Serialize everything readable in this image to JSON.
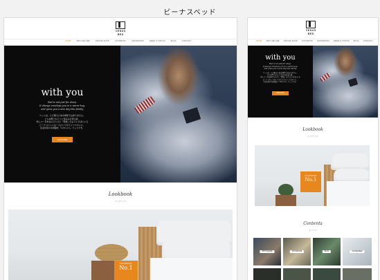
{
  "page_title": "ビーナスベッド",
  "brand": {
    "line1": "VENUS",
    "line2": "BED"
  },
  "nav": [
    "HOME",
    "WHO WE ARE",
    "ONLINE SHOP",
    "LOOKBOOK",
    "SHOWROOM",
    "NEWS & TOPICS",
    "BLOG",
    "CONTACT"
  ],
  "hero": {
    "heading": "with you",
    "sub": [
      "Bed is not just for sleep.",
      "It always envelops you in a warm hug,",
      "and gives you a new day like family."
    ],
    "jp": [
      "ベッドは、ただ眠るための場所ではありません。",
      "どんな時でもそっと包み込む安心感、",
      "新しい一日を迎えるたびに「家族」のようにそばにいる",
      "ビーナスベッドは一人ひとりのライフスタイル、",
      "生活の様々な場面を「with you」ベッドです。"
    ],
    "button": "EXPLORE"
  },
  "lookbook": {
    "title": "Lookbook",
    "sub": "ルックブック"
  },
  "lookbook_tag": {
    "small": "LOOKBOOK",
    "big": "No.1"
  },
  "contents": {
    "title": "Contents",
    "sub": "コンテンツ"
  },
  "content_thumbs": [
    "WHO WE ARE",
    "SHOWROOM",
    "BLOG",
    "WONDERBED"
  ],
  "colors": {
    "accent": "#e8871e",
    "hero_bg": "#0b0b0b"
  }
}
